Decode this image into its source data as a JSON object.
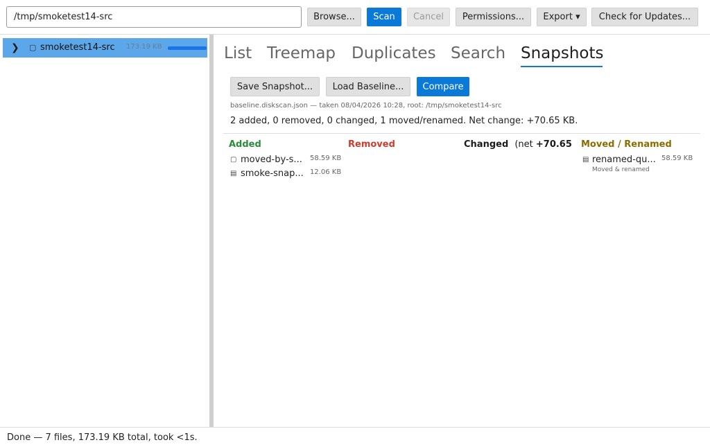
{
  "toolbar": {
    "path_value": "/tmp/smoketest14-src",
    "browse_label": "Browse...",
    "scan_label": "Scan",
    "cancel_label": "Cancel",
    "permissions_label": "Permissions...",
    "export_label": "Export ▾",
    "updates_label": "Check for Updates..."
  },
  "tree": {
    "items": [
      {
        "name": "smoketest14-src",
        "size": "173.19 KB",
        "expand_icon": "chevron-right-icon",
        "type_icon": "file-icon",
        "usage_fraction": 1.0
      }
    ]
  },
  "tabs": [
    {
      "label": "List",
      "active": false
    },
    {
      "label": "Treemap",
      "active": false
    },
    {
      "label": "Duplicates",
      "active": false
    },
    {
      "label": "Search",
      "active": false
    },
    {
      "label": "Snapshots",
      "active": true
    }
  ],
  "snapshots": {
    "save_label": "Save Snapshot...",
    "load_label": "Load Baseline...",
    "compare_label": "Compare",
    "baseline_info": "baseline.diskscan.json — taken 08/04/2026 10:28, root: /tmp/smoketest14-src",
    "summary": "2 added, 0 removed, 0 changed, 1 moved/renamed. Net change: +70.65 KB.",
    "columns": {
      "added": "Added",
      "removed": "Removed",
      "changed": "Changed",
      "changed_net_prefix": "(net ",
      "changed_net_value": "+70.65",
      "moved": "Moved / Renamed"
    },
    "added_items": [
      {
        "name": "moved-by-s...",
        "size": "58.59 KB",
        "icon": "file-icon"
      },
      {
        "name": "smoke-snap...",
        "size": "12.06 KB",
        "icon": "document-icon"
      }
    ],
    "moved_items": [
      {
        "name": "renamed-qu...",
        "size": "58.59 KB",
        "note": "Moved & renamed",
        "icon": "document-icon"
      }
    ]
  },
  "status": {
    "text": "Done — 7 files, 173.19 KB total, took <1s."
  },
  "colors": {
    "accent": "#0a79d8",
    "selection": "#5ba7ea",
    "added": "#2e8b3c",
    "removed": "#cf3b2f",
    "moved": "#8a6d00"
  }
}
